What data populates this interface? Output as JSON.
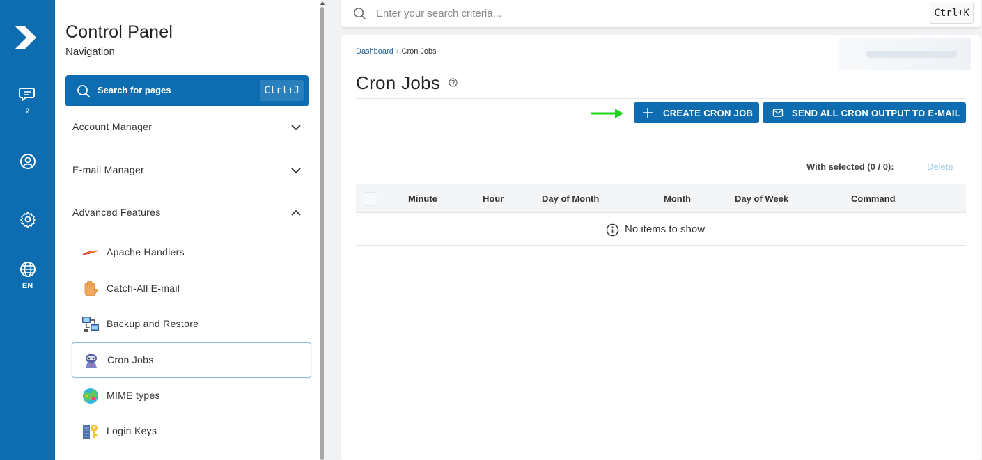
{
  "rail": {
    "messages_badge": "2",
    "language": "EN"
  },
  "sidebar": {
    "title": "Control Panel",
    "subtitle": "Navigation",
    "search_label": "Search for pages",
    "search_shortcut": "Ctrl+J",
    "sections": [
      {
        "label": "Account Manager",
        "state": "collapsed"
      },
      {
        "label": "E-mail Manager",
        "state": "collapsed"
      },
      {
        "label": "Advanced Features",
        "state": "expanded"
      }
    ],
    "items": [
      {
        "label": "Apache Handlers",
        "icon": "apache-feather-icon"
      },
      {
        "label": "Catch-All E-mail",
        "icon": "hand-icon"
      },
      {
        "label": "Backup and Restore",
        "icon": "backup-computers-icon"
      },
      {
        "label": "Cron Jobs",
        "icon": "robot-icon",
        "active": true
      },
      {
        "label": "MIME types",
        "icon": "globe-colorful-icon"
      },
      {
        "label": "Login Keys",
        "icon": "key-icon"
      }
    ]
  },
  "topbar": {
    "search_placeholder": "Enter your search criteria...",
    "shortcut": "Ctrl+K"
  },
  "main": {
    "breadcrumb": [
      "Dashboard",
      "Cron Jobs"
    ],
    "title": "Cron Jobs",
    "create_button": "CREATE CRON JOB",
    "send_button": "SEND ALL CRON OUTPUT TO E-MAIL",
    "with_selected": "With selected (0 / 0):",
    "delete_label": "Delete",
    "columns": [
      "Minute",
      "Hour",
      "Day of Month",
      "Month",
      "Day of Week",
      "Command"
    ],
    "empty_message": "No items to show"
  },
  "colors": {
    "brand": "#0e6db0",
    "annotation_arrow": "#1ed41e"
  }
}
